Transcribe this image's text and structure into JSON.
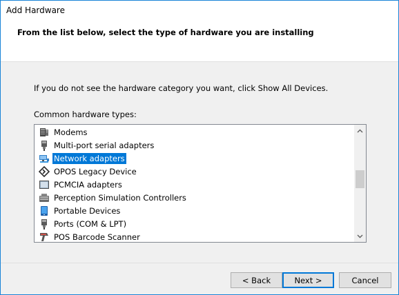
{
  "window": {
    "title": "Add Hardware"
  },
  "header": {
    "subtitle": "From the list below, select the type of hardware you are installing"
  },
  "instruction": "If you do not see the hardware category you want, click Show All Devices.",
  "list": {
    "label": "Common hardware types:",
    "items": [
      {
        "label": "Modems",
        "icon": "modem-icon"
      },
      {
        "label": "Multi-port serial adapters",
        "icon": "serial-adapter-icon"
      },
      {
        "label": "Network adapters",
        "icon": "network-adapter-icon",
        "selected": true
      },
      {
        "label": "OPOS Legacy Device",
        "icon": "opos-device-icon"
      },
      {
        "label": "PCMCIA adapters",
        "icon": "pcmcia-icon"
      },
      {
        "label": "Perception Simulation Controllers",
        "icon": "perception-controller-icon"
      },
      {
        "label": "Portable Devices",
        "icon": "portable-device-icon"
      },
      {
        "label": "Ports (COM & LPT)",
        "icon": "port-icon"
      },
      {
        "label": "POS Barcode Scanner",
        "icon": "barcode-scanner-icon"
      }
    ]
  },
  "buttons": {
    "back": "< Back",
    "next": "Next >",
    "cancel": "Cancel"
  },
  "colors": {
    "selection": "#0078d7",
    "window_border": "#1883d7",
    "dialog_background": "#f0f0f0"
  }
}
